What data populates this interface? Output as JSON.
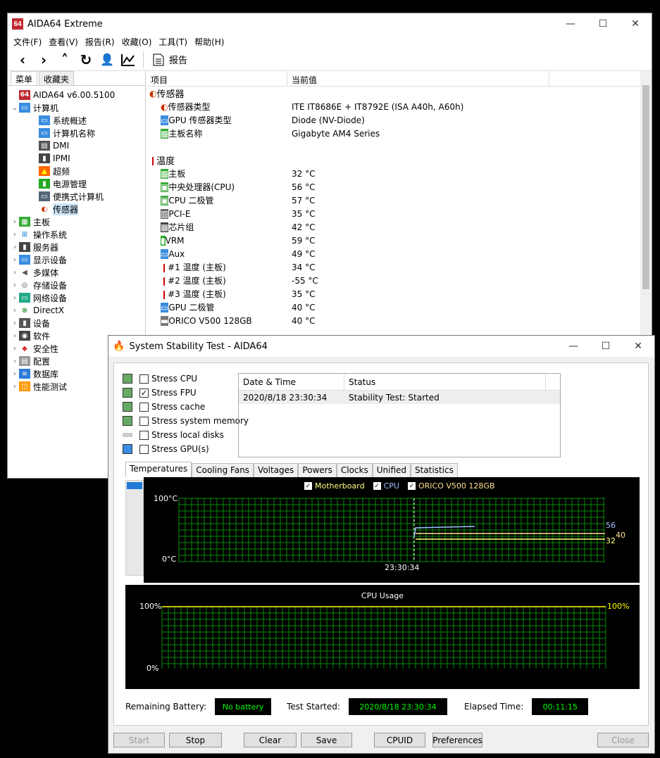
{
  "main": {
    "title": "AIDA64 Extreme",
    "menu": [
      "文件(F)",
      "查看(V)",
      "报告(R)",
      "收藏(O)",
      "工具(T)",
      "帮助(H)"
    ],
    "toolbar_report": "报告",
    "left_tabs": [
      "菜单",
      "收藏夹"
    ],
    "tree": [
      {
        "label": "AIDA64 v6.00.5100",
        "level": 0,
        "exp": "",
        "icon": "aida-logo-icon"
      },
      {
        "label": "计算机",
        "level": 0,
        "exp": "⌄",
        "icon": "computer-icon"
      },
      {
        "label": "系统概述",
        "level": 1,
        "exp": "",
        "icon": "monitor-icon"
      },
      {
        "label": "计算机名称",
        "level": 1,
        "exp": "",
        "icon": "monitor-icon"
      },
      {
        "label": "DMI",
        "level": 1,
        "exp": "",
        "icon": "dmi-icon"
      },
      {
        "label": "IPMI",
        "level": 1,
        "exp": "",
        "icon": "ipmi-icon"
      },
      {
        "label": "超频",
        "level": 1,
        "exp": "",
        "icon": "flame-icon"
      },
      {
        "label": "电源管理",
        "level": 1,
        "exp": "",
        "icon": "battery-icon"
      },
      {
        "label": "便携式计算机",
        "level": 1,
        "exp": "",
        "icon": "laptop-icon"
      },
      {
        "label": "传感器",
        "level": 1,
        "exp": "",
        "icon": "gauge-icon",
        "selected": true
      },
      {
        "label": "主板",
        "level": 0,
        "exp": "›",
        "icon": "motherboard-icon"
      },
      {
        "label": "操作系统",
        "level": 0,
        "exp": "›",
        "icon": "windows-icon"
      },
      {
        "label": "服务器",
        "level": 0,
        "exp": "›",
        "icon": "server-icon"
      },
      {
        "label": "显示设备",
        "level": 0,
        "exp": "›",
        "icon": "display-icon"
      },
      {
        "label": "多媒体",
        "level": 0,
        "exp": "›",
        "icon": "speaker-icon"
      },
      {
        "label": "存储设备",
        "level": 0,
        "exp": "›",
        "icon": "disk-icon"
      },
      {
        "label": "网络设备",
        "level": 0,
        "exp": "›",
        "icon": "network-icon"
      },
      {
        "label": "DirectX",
        "level": 0,
        "exp": "›",
        "icon": "xbox-icon"
      },
      {
        "label": "设备",
        "level": 0,
        "exp": "›",
        "icon": "device-icon"
      },
      {
        "label": "软件",
        "level": 0,
        "exp": "›",
        "icon": "software-icon"
      },
      {
        "label": "安全性",
        "level": 0,
        "exp": "›",
        "icon": "shield-icon"
      },
      {
        "label": "配置",
        "level": 0,
        "exp": "›",
        "icon": "config-icon"
      },
      {
        "label": "数据库",
        "level": 0,
        "exp": "›",
        "icon": "database-icon"
      },
      {
        "label": "性能测试",
        "level": 0,
        "exp": "›",
        "icon": "benchmark-icon"
      }
    ],
    "col_item": "项目",
    "col_value": "当前值",
    "rows": [
      {
        "item": "传感器",
        "value": "",
        "group": true,
        "icon": "gauge-icon"
      },
      {
        "item": "传感器类型",
        "value": "ITE IT8686E + IT8792E  (ISA A40h, A60h)",
        "icon": "gauge-icon"
      },
      {
        "item": "GPU 传感器类型",
        "value": "Diode  (NV-Diode)",
        "icon": "display-icon"
      },
      {
        "item": "主板名称",
        "value": "Gigabyte AM4 Series",
        "icon": "motherboard-icon"
      },
      {
        "item": "",
        "value": "",
        "spacer": true
      },
      {
        "item": "温度",
        "value": "",
        "group": true,
        "icon": "thermometer-icon"
      },
      {
        "item": "主板",
        "value": "32 °C",
        "icon": "motherboard-icon"
      },
      {
        "item": "中央处理器(CPU)",
        "value": "56 °C",
        "icon": "cpu-icon"
      },
      {
        "item": "CPU 二极管",
        "value": "57 °C",
        "icon": "cpu-icon"
      },
      {
        "item": "PCI-E",
        "value": "35 °C",
        "icon": "pcie-icon"
      },
      {
        "item": "芯片组",
        "value": "42 °C",
        "icon": "chipset-icon"
      },
      {
        "item": "VRM",
        "value": "59 °C",
        "icon": "battery-icon"
      },
      {
        "item": "Aux",
        "value": "49 °C",
        "icon": "display-icon"
      },
      {
        "item": "#1 温度 (主板)",
        "value": "34 °C",
        "icon": "thermometer-icon"
      },
      {
        "item": "#2 温度 (主板)",
        "value": "-55 °C",
        "icon": "thermometer-icon"
      },
      {
        "item": "#3 温度 (主板)",
        "value": "35 °C",
        "icon": "thermometer-icon"
      },
      {
        "item": "GPU 二极管",
        "value": "40 °C",
        "icon": "display-icon"
      },
      {
        "item": "ORICO V500 128GB",
        "value": "40 °C",
        "icon": "ssd-icon"
      }
    ]
  },
  "sst": {
    "title": "System Stability Test - AIDA64",
    "stress": [
      {
        "label": "Stress CPU",
        "checked": false
      },
      {
        "label": "Stress FPU",
        "checked": true
      },
      {
        "label": "Stress cache",
        "checked": false
      },
      {
        "label": "Stress system memory",
        "checked": false
      },
      {
        "label": "Stress local disks",
        "checked": false
      },
      {
        "label": "Stress GPU(s)",
        "checked": false
      }
    ],
    "log_headers": [
      "Date & Time",
      "Status"
    ],
    "log_rows": [
      {
        "date": "2020/8/18 23:30:34",
        "status": "Stability Test: Started"
      }
    ],
    "tabs": [
      "Temperatures",
      "Cooling Fans",
      "Voltages",
      "Powers",
      "Clocks",
      "Unified",
      "Statistics"
    ],
    "legend": [
      {
        "label": "Motherboard",
        "color": "#ffff80"
      },
      {
        "label": "CPU",
        "color": "#a0c0ff"
      },
      {
        "label": "ORICO V500 128GB",
        "color": "#ffe090"
      }
    ],
    "temp_ymax": "100°C",
    "temp_ymin": "0°C",
    "temp_time": "23:30:34",
    "temp_values": {
      "cpu": "56",
      "ssd": "40",
      "mb": "32"
    },
    "cpu_title": "CPU Usage",
    "cpu_ymax": "100%",
    "cpu_ymin": "0%",
    "cpu_value": "100%",
    "battery_label": "Remaining Battery:",
    "battery_value": "No battery",
    "started_label": "Test Started:",
    "started_value": "2020/8/18 23:30:34",
    "elapsed_label": "Elapsed Time:",
    "elapsed_value": "00:11:15",
    "buttons": {
      "start": "Start",
      "stop": "Stop",
      "clear": "Clear",
      "save": "Save",
      "cpuid": "CPUID",
      "prefs": "Preferences",
      "close": "Close"
    }
  }
}
